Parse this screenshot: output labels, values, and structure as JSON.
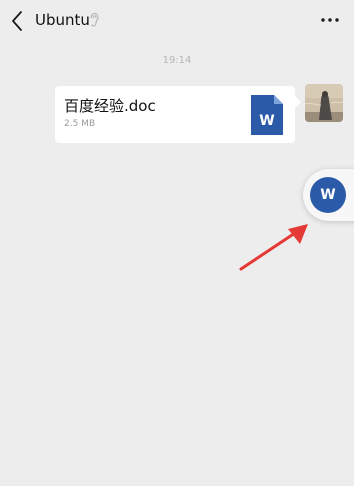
{
  "header": {
    "title": "Ubuntu",
    "back_icon": "chevron-left-icon",
    "ear_icon": "ear-icon",
    "more_icon": "more-dots-icon"
  },
  "chat": {
    "timestamp": "19:14",
    "message": {
      "file_name": "百度经验.doc",
      "file_size": "2.5 MB",
      "file_icon": "word-document-icon",
      "icon_letter": "W"
    }
  },
  "floating_window": {
    "icon_letter": "W"
  },
  "colors": {
    "background": "#ededed",
    "bubble": "#ffffff",
    "word_blue": "#2b5aa8",
    "arrow_red": "#e53935"
  }
}
